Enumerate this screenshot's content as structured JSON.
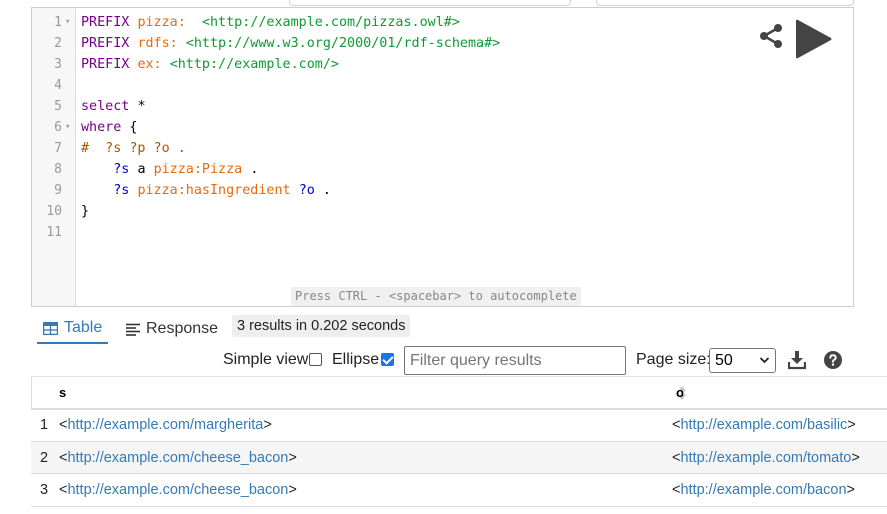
{
  "editor": {
    "lines": [
      {
        "num": "1",
        "fold": true
      },
      {
        "num": "2"
      },
      {
        "num": "3"
      },
      {
        "num": "4"
      },
      {
        "num": "5"
      },
      {
        "num": "6",
        "fold": true
      },
      {
        "num": "7"
      },
      {
        "num": "8"
      },
      {
        "num": "9"
      },
      {
        "num": "10"
      },
      {
        "num": "11"
      }
    ],
    "code": {
      "l1_kw": "PREFIX",
      "l1_pfx": "pizza:",
      "l1_iri": "<http://example.com/pizzas.owl#>",
      "l2_kw": "PREFIX",
      "l2_pfx": "rdfs:",
      "l2_iri": "<http://www.w3.org/2000/01/rdf-schema#>",
      "l3_kw": "PREFIX",
      "l3_pfx": "ex:",
      "l3_iri": "<http://example.com/>",
      "l5_kw": "select",
      "l5_rest": "*",
      "l6_kw": "where",
      "l6_rest": "{",
      "l7_cmt": "#  ?s ?p ?o .",
      "l8_var": "?s",
      "l8_a": "a",
      "l8_pfx": "pizza:Pizza",
      "l8_dot": ".",
      "l9_var": "?s",
      "l9_pfx": "pizza:hasIngredient",
      "l9_var2": "?o",
      "l9_dot": ".",
      "l10": "}"
    },
    "hint": "Press CTRL - <spacebar> to autocomplete",
    "share_icon": "share-icon",
    "run_icon": "play-icon"
  },
  "results": {
    "tabs": [
      {
        "label": "Table",
        "icon": "table-icon",
        "active": true
      },
      {
        "label": "Response",
        "icon": "response-lines-icon",
        "active": false
      }
    ],
    "summary": "3 results in 0.202 seconds",
    "simple_view_label": "Simple view",
    "simple_view_checked": false,
    "ellipse_label": "Ellipse",
    "ellipse_checked": true,
    "filter_placeholder": "Filter query results",
    "page_size_label": "Page size:",
    "page_size_value": "50",
    "download_icon": "download-icon",
    "help_icon": "help-icon",
    "columns": [
      "s",
      "o"
    ],
    "rows": [
      {
        "index": "1",
        "s": "http://example.com/margherita",
        "o": "http://example.com/basilic"
      },
      {
        "index": "2",
        "s": "http://example.com/cheese_bacon",
        "o": "http://example.com/tomato"
      },
      {
        "index": "3",
        "s": "http://example.com/cheese_bacon",
        "o": "http://example.com/bacon"
      }
    ],
    "lt": "<",
    "gt": ">"
  },
  "colors": {
    "keyword": "#770088",
    "prefix": "#e96a0b",
    "iri": "#119933",
    "variable": "#0000cc",
    "link": "#337ab7",
    "accent": "#337ab7"
  }
}
